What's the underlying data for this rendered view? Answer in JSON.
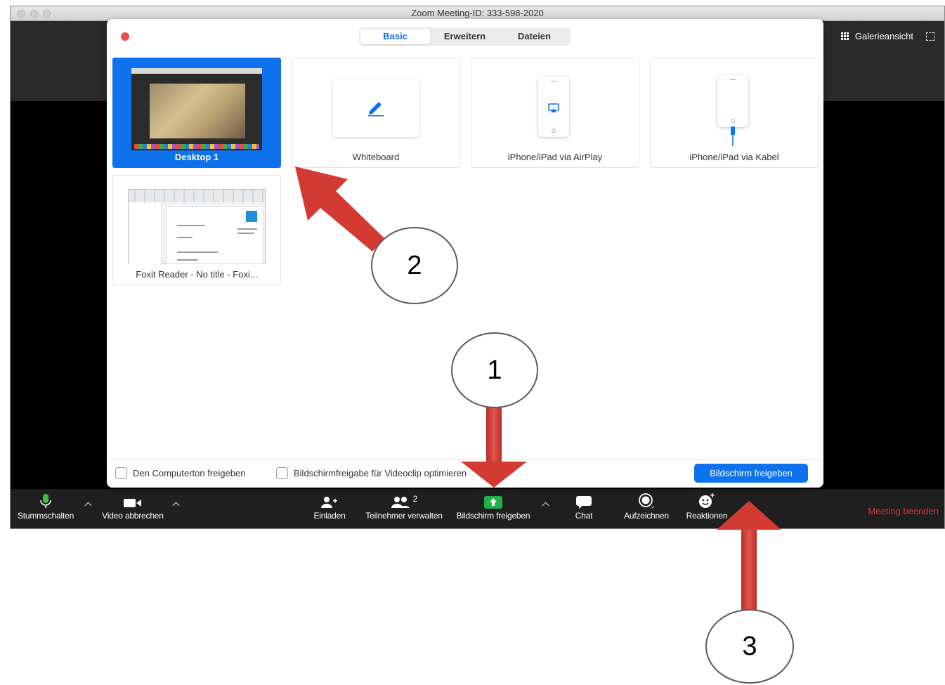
{
  "window": {
    "title": "Zoom Meeting-ID: 333-598-2020",
    "gallery_label": "Galerieansicht"
  },
  "dialog": {
    "tabs": [
      "Basic",
      "Erweitern",
      "Dateien"
    ],
    "active_tab": "Basic",
    "tiles": [
      {
        "label": "Desktop 1",
        "selected": true
      },
      {
        "label": "Whiteboard",
        "selected": false
      },
      {
        "label": "iPhone/iPad via AirPlay",
        "selected": false
      },
      {
        "label": "iPhone/iPad via Kabel",
        "selected": false
      },
      {
        "label": "Foxit Reader - No title - Foxi...",
        "selected": false
      }
    ],
    "footer": {
      "checkbox_audio": "Den Computerton freigeben",
      "checkbox_video": "Bildschirmfreigabe für Videoclip optimieren",
      "share_button": "Bildschirm freigeben"
    }
  },
  "toolbar": {
    "mute": "Stummschalten",
    "video": "Video abbrechen",
    "invite": "Einladen",
    "participants": "Teilnehmer verwalten",
    "participants_count": "2",
    "share": "Bildschirm freigeben",
    "chat": "Chat",
    "record": "Aufzeichnen",
    "reactions": "Reaktionen",
    "end": "Meeting beenden"
  },
  "annotations": [
    "1",
    "2",
    "3"
  ],
  "colors": {
    "accent_blue": "#0e72ed",
    "share_green": "#21b14b",
    "end_red": "#e0322f",
    "arrow_red": "#d23a32"
  }
}
